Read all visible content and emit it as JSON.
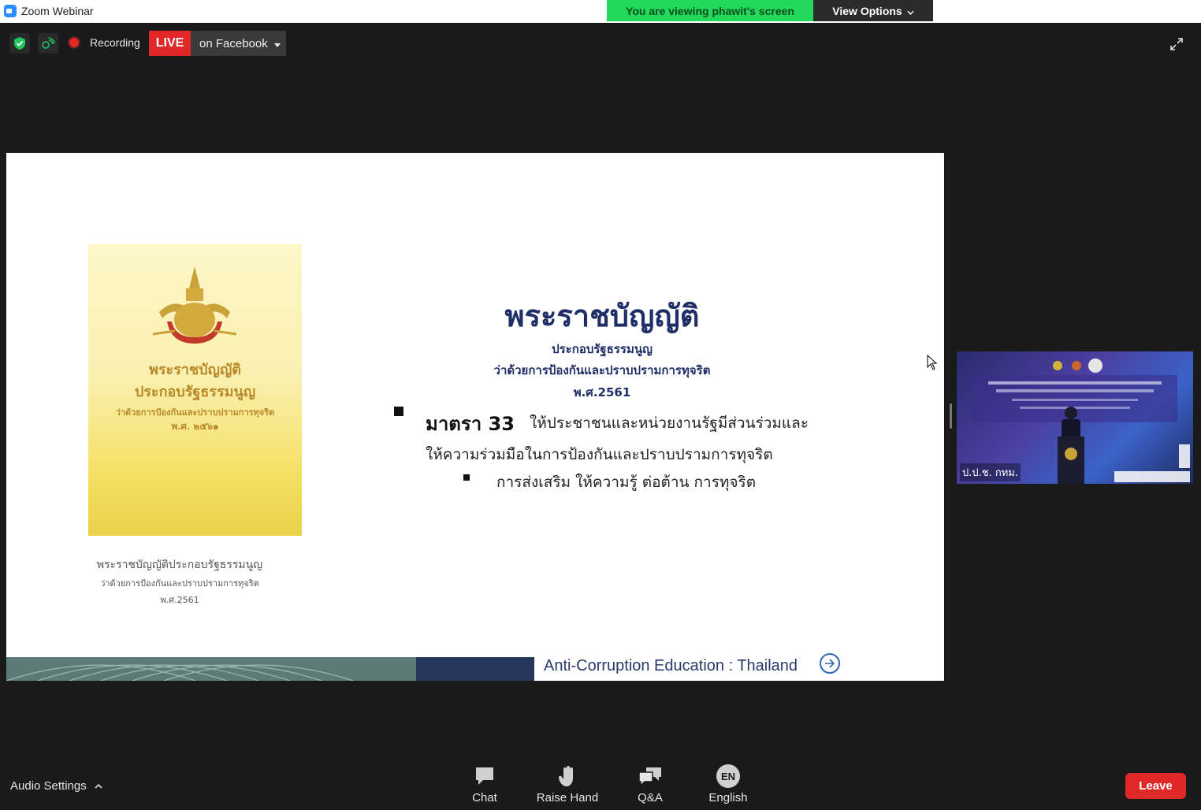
{
  "window": {
    "title": "Zoom Webinar"
  },
  "banner": {
    "viewing": "You are viewing phawit's screen",
    "view_options": "View Options"
  },
  "status": {
    "recording": "Recording",
    "live": "LIVE",
    "live_dest": "on Facebook"
  },
  "slide": {
    "book_title_1": "พระราชบัญญัติ",
    "book_title_2": "ประกอบรัฐธรรมนูญ",
    "book_title_3": "ว่าด้วยการป้องกันและปราบปรามการทุจริต",
    "book_title_4": "พ.ศ. ๒๕๖๑",
    "caption_1": "พระราชบัญญัติประกอบรัฐธรรมนูญ",
    "caption_2": "ว่าด้วยการป้องกันและปราบปรามการทุจริต",
    "caption_3": "พ.ศ.2561",
    "title": "พระราชบัญญัติ",
    "subtitle_1": "ประกอบรัฐธรรมนูญ",
    "subtitle_2": "ว่าด้วยการป้องกันและปราบปรามการทุจริต",
    "subtitle_3": "พ.ศ.2561",
    "section_label": "มาตรา 33",
    "section_text": "ให้ประชาชนและหน่วยงานรัฐมีส่วนร่วมและ",
    "section_text_2": "ให้ความร่วมมือในการป้องกันและปราบปรามการทุจริต",
    "sub_bullet": "การส่งเสริม ให้ความรู้ ต่อต้าน การทุจริต",
    "footer": "Anti-Corruption Education : Thailand"
  },
  "video": {
    "name": "ป.ป.ช. กทม."
  },
  "toolbar": {
    "audio_settings": "Audio Settings",
    "chat": "Chat",
    "raise_hand": "Raise Hand",
    "qa": "Q&A",
    "language_badge": "EN",
    "language": "English",
    "leave": "Leave"
  }
}
